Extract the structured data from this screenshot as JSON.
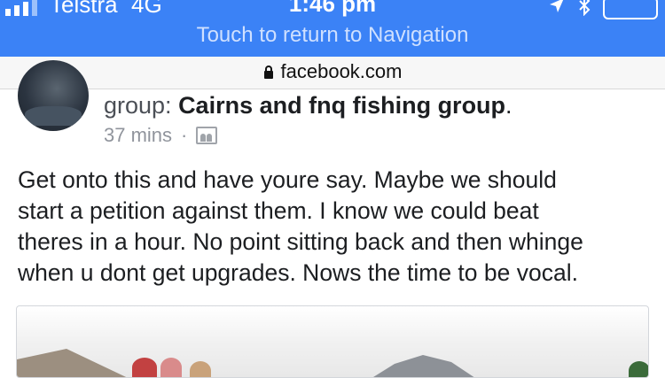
{
  "status_bar": {
    "carrier": "Telstra",
    "network": "4G",
    "time": "1:46 pm",
    "return_banner": "Touch to return to Navigation",
    "icons": [
      "location-arrow-icon",
      "bluetooth-icon",
      "battery-icon"
    ]
  },
  "browser": {
    "url": "facebook.com",
    "lock_icon": "lock-icon"
  },
  "post": {
    "group_prefix": "group: ",
    "group_name": "Cairns and fnq fishing group",
    "group_suffix": ".",
    "time_ago": "37 mins",
    "separator": "·",
    "privacy_icon": "group-privacy-icon",
    "text_lines": [
      "Get onto this and have youre say. Maybe we should",
      "start a petition against them. I know we could beat",
      "theres in a hour. No point sitting back and then whinge",
      "when u dont get upgrades. Nows the time to be vocal."
    ]
  },
  "colors": {
    "status_blue": "#3b82f6",
    "banner_text": "#cfe0ff",
    "text_primary": "#1c1e21",
    "text_meta": "#90949c"
  }
}
